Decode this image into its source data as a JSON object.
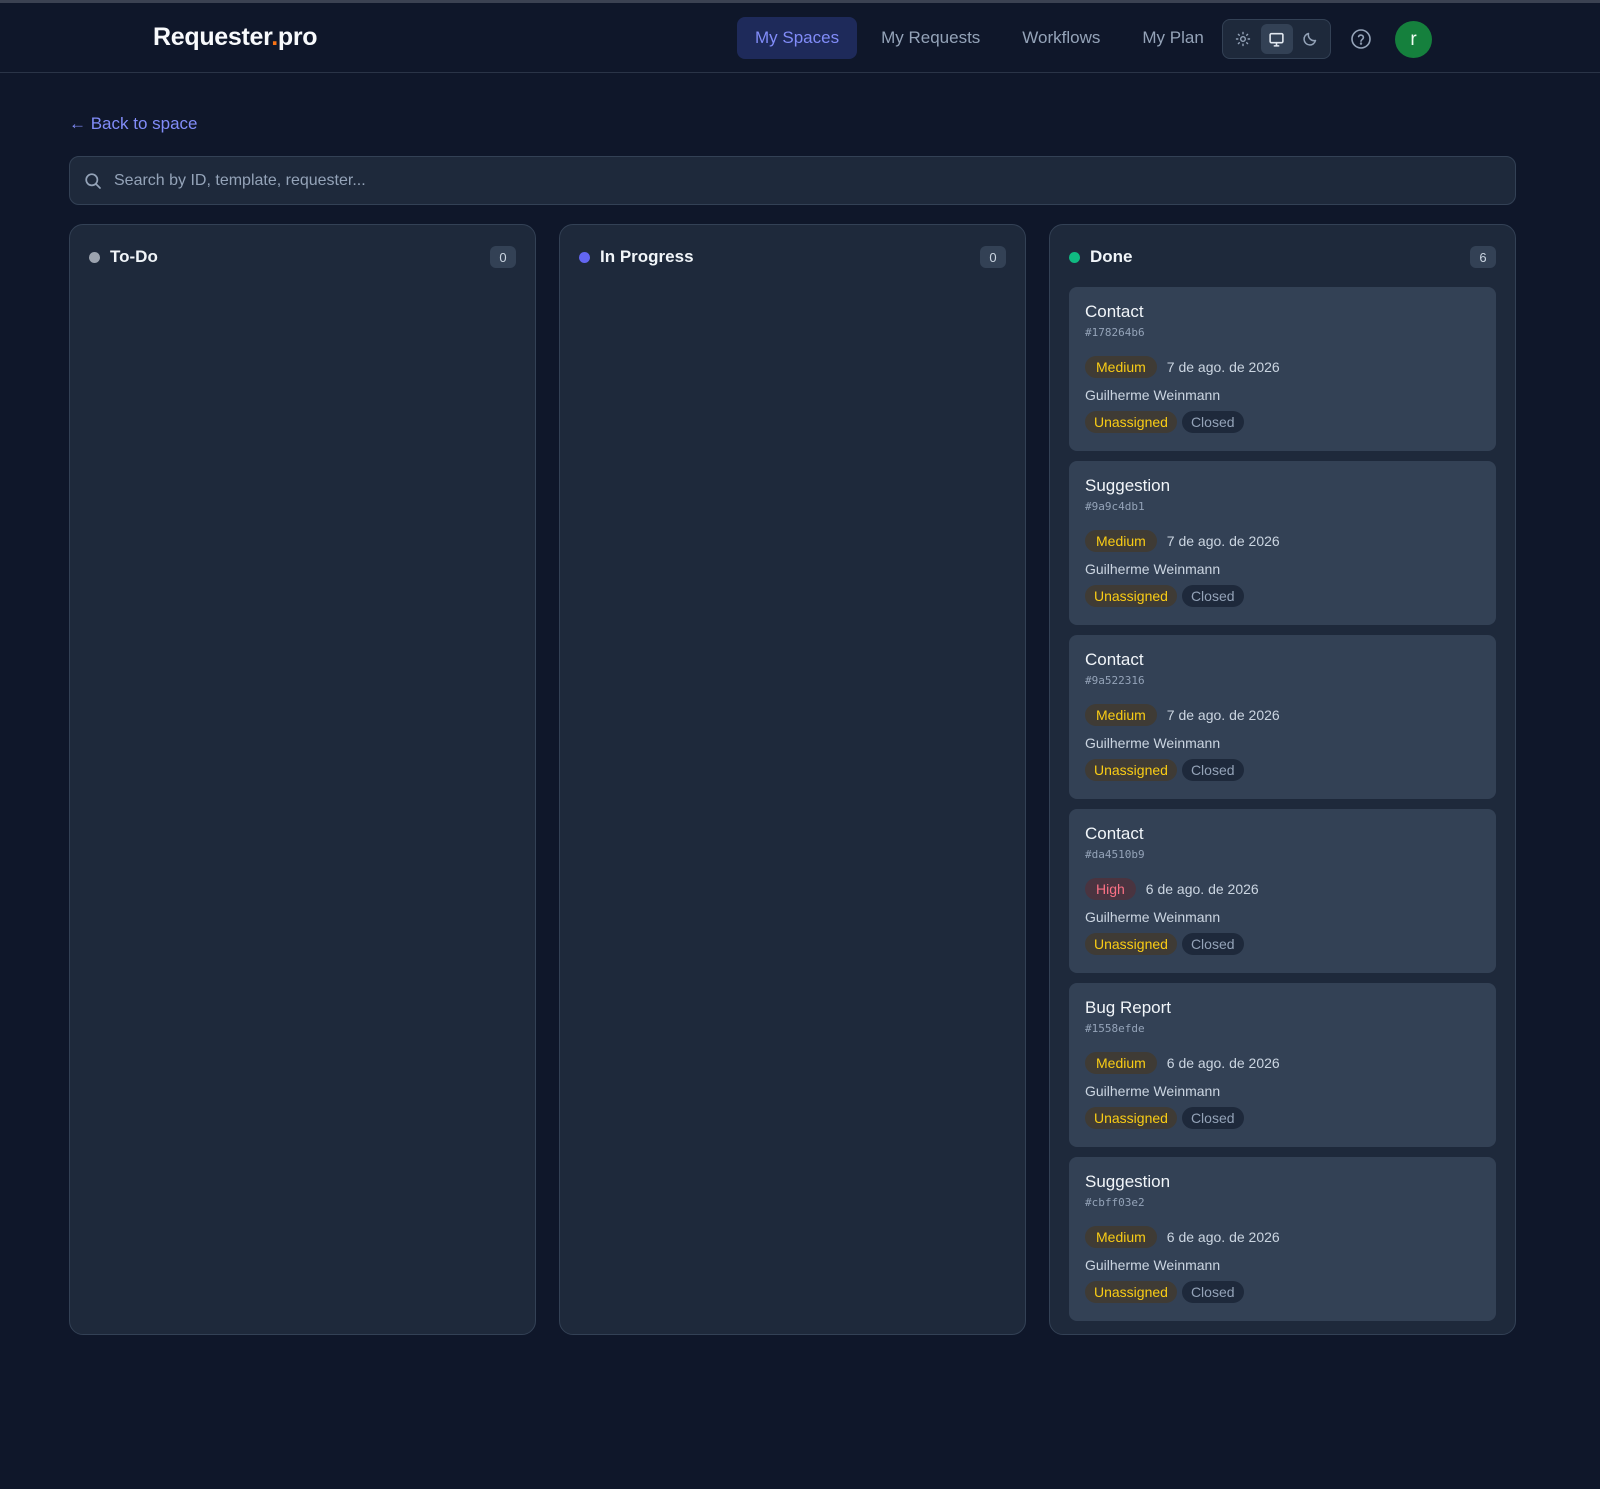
{
  "header": {
    "logo_main": "Requester",
    "logo_dot": ".",
    "logo_tld": "pro",
    "nav": [
      {
        "label": "My Spaces",
        "active": true
      },
      {
        "label": "My Requests",
        "active": false
      },
      {
        "label": "Workflows",
        "active": false
      },
      {
        "label": "My Plan",
        "active": false
      }
    ],
    "theme_options": [
      "sun-icon",
      "monitor-icon",
      "moon-icon"
    ],
    "theme_selected": "monitor-icon",
    "avatar_initial": "r"
  },
  "back_link": "← Back to space",
  "search": {
    "placeholder": "Search by ID, template, requester...",
    "value": ""
  },
  "columns": [
    {
      "title": "To-Do",
      "count": "0",
      "dot_color": "#9ca3af",
      "cards": []
    },
    {
      "title": "In Progress",
      "count": "0",
      "dot_color": "#6366f1",
      "cards": []
    },
    {
      "title": "Done",
      "count": "6",
      "dot_color": "#10b981",
      "cards": [
        {
          "title": "Contact",
          "id": "#178264b6",
          "priority": "Medium",
          "date": "7 de ago. de 2026",
          "requester": "Guilherme Weinmann",
          "assignee": "Unassigned",
          "status": "Closed"
        },
        {
          "title": "Suggestion",
          "id": "#9a9c4db1",
          "priority": "Medium",
          "date": "7 de ago. de 2026",
          "requester": "Guilherme Weinmann",
          "assignee": "Unassigned",
          "status": "Closed"
        },
        {
          "title": "Contact",
          "id": "#9a522316",
          "priority": "Medium",
          "date": "7 de ago. de 2026",
          "requester": "Guilherme Weinmann",
          "assignee": "Unassigned",
          "status": "Closed"
        },
        {
          "title": "Contact",
          "id": "#da4510b9",
          "priority": "High",
          "date": "6 de ago. de 2026",
          "requester": "Guilherme Weinmann",
          "assignee": "Unassigned",
          "status": "Closed"
        },
        {
          "title": "Bug Report",
          "id": "#1558efde",
          "priority": "Medium",
          "date": "6 de ago. de 2026",
          "requester": "Guilherme Weinmann",
          "assignee": "Unassigned",
          "status": "Closed"
        },
        {
          "title": "Suggestion",
          "id": "#cbff03e2",
          "priority": "Medium",
          "date": "6 de ago. de 2026",
          "requester": "Guilherme Weinmann",
          "assignee": "Unassigned",
          "status": "Closed"
        }
      ]
    }
  ]
}
